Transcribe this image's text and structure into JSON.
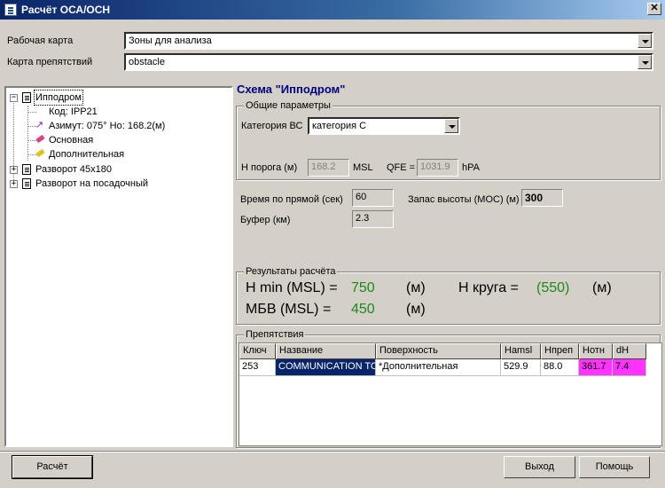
{
  "window": {
    "title": "Расчёт ОСА/ОСН",
    "close": "✕"
  },
  "top": {
    "work_map_label": "Рабочая карта",
    "work_map_value": "Зоны для анализа",
    "obstacle_map_label": "Карта препятствий",
    "obstacle_map_value": "obstacle"
  },
  "tree": {
    "items": [
      {
        "label": "Ипподром"
      },
      {
        "label": "Код:  IPP21"
      },
      {
        "label": "Азимут: 075°  Но: 168.2(м)"
      },
      {
        "label": "Основная"
      },
      {
        "label": "Дополнительная"
      },
      {
        "label": "Разворот 45х180"
      },
      {
        "label": "Разворот на посадочный"
      }
    ]
  },
  "scheme": {
    "title": "Схема \"Ипподром\"",
    "general_group": "Общие параметры",
    "category_label": "Категория ВС",
    "category_value": "категория С",
    "threshold_label": "Н порога (м)",
    "threshold_value": "168.2",
    "msl_unit": "MSL",
    "qfe_label": "QFE =",
    "qfe_value": "1031.9",
    "qfe_unit": "hPA",
    "time_label": "Время по прямой (сек)",
    "time_value": "60",
    "buffer_label": "Буфер (км)",
    "buffer_value": "2.3",
    "moc_label": "Запас высоты (МОС) (м)",
    "moc_value": "300"
  },
  "results": {
    "group": "Результаты расчёта",
    "hmin_label": "H min (MSL) =",
    "hmin_value": "750",
    "hmin_unit": "(м)",
    "hcircle_label": "Н круга =",
    "hcircle_value": "(550)",
    "hcircle_unit": "(м)",
    "mbv_label": "МБВ (MSL) =",
    "mbv_value": "450",
    "mbv_unit": "(м)"
  },
  "obstacles": {
    "group": "Препятствия",
    "columns": [
      "Ключ",
      "Название",
      "Поверхность",
      "Hamsl",
      "Нпреп",
      "Нотн",
      "dH"
    ],
    "rows": [
      [
        "253",
        "COMMUNICATION TO",
        "*Дополнительная",
        "529.9",
        "88.0",
        "361.7",
        "7.4"
      ]
    ]
  },
  "buttons": {
    "calc": "Расчёт",
    "exit": "Выход",
    "help": "Помощь"
  },
  "colors": {
    "highlight": "#0a246a",
    "magenta": "#ff33ff",
    "result_green": "#1a8a1a",
    "title_blue": "#000080"
  }
}
